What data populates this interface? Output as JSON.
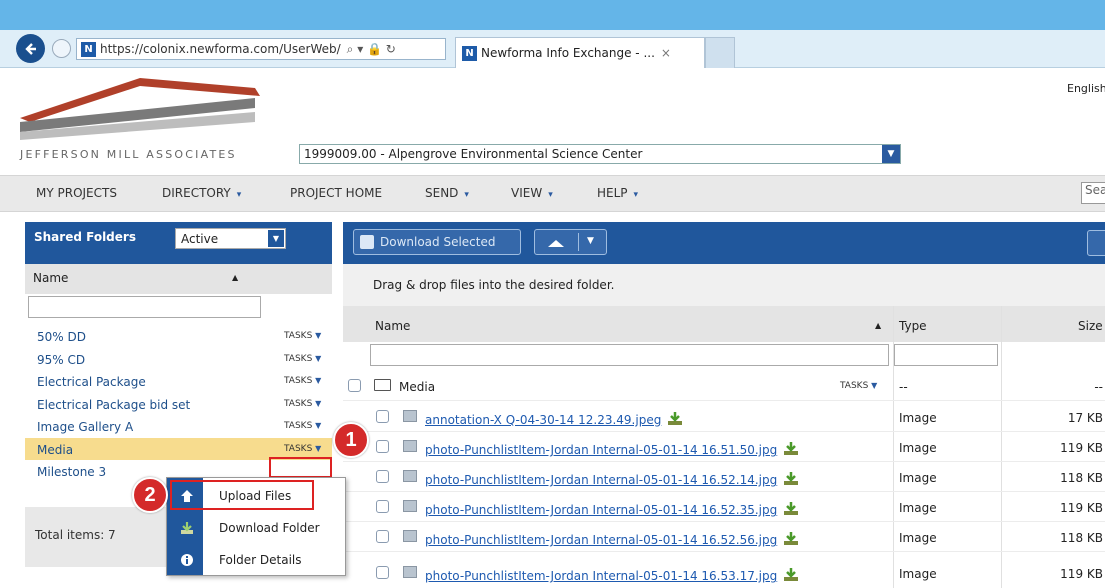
{
  "browser": {
    "url": "https://colonix.newforma.com/UserWeb/",
    "url_icons": "⌕ ▾ 🔒 ↻",
    "tab_title": "Newforma Info Exchange - ...",
    "tab_close": "×",
    "favicon_letter": "N"
  },
  "header": {
    "language": "English",
    "company": "JEFFERSON MILL ASSOCIATES",
    "project": "1999009.00 - Alpengrove Environmental Science Center"
  },
  "menu": {
    "items": [
      {
        "label": "MY PROJECTS",
        "caret": ""
      },
      {
        "label": "DIRECTORY",
        "caret": "▾"
      },
      {
        "label": "PROJECT HOME",
        "caret": ""
      },
      {
        "label": "SEND",
        "caret": "▾"
      },
      {
        "label": "VIEW",
        "caret": "▾"
      },
      {
        "label": "HELP",
        "caret": "▾"
      }
    ],
    "search_placeholder": "Sea"
  },
  "shared_folders": {
    "title": "Shared Folders",
    "filter_value": "Active",
    "column": "Name",
    "tasks_label": "TASKS",
    "folders": [
      "50% DD",
      "95% CD",
      "Electrical Package",
      "Electrical Package bid set",
      "Image Gallery A",
      "Media",
      "Milestone 3"
    ],
    "selected": "Media",
    "total": "Total items: 7"
  },
  "context_menu": {
    "items": [
      "Upload Files",
      "Download Folder",
      "Folder Details"
    ]
  },
  "callouts": [
    "1",
    "2"
  ],
  "files": {
    "download_selected": "Download Selected",
    "drag_hint": "Drag & drop files into the desired folder.",
    "col_name": "Name",
    "col_type": "Type",
    "col_size": "Size",
    "folder_row": {
      "name": "Media",
      "tasks": "TASKS",
      "type": "--",
      "size": "--"
    },
    "rows": [
      {
        "name": "annotation-X Q-04-30-14 12.23.49.jpeg",
        "type": "Image",
        "size": "17 KB"
      },
      {
        "name": "photo-PunchlistItem-Jordan Internal-05-01-14 16.51.50.jpg",
        "type": "Image",
        "size": "119 KB"
      },
      {
        "name": "photo-PunchlistItem-Jordan Internal-05-01-14 16.52.14.jpg",
        "type": "Image",
        "size": "118 KB"
      },
      {
        "name": "photo-PunchlistItem-Jordan Internal-05-01-14 16.52.35.jpg",
        "type": "Image",
        "size": "119 KB"
      },
      {
        "name": "photo-PunchlistItem-Jordan Internal-05-01-14 16.52.56.jpg",
        "type": "Image",
        "size": "118 KB"
      },
      {
        "name": "photo-PunchlistItem-Jordan Internal-05-01-14 16.53.17.jpg",
        "type": "Image",
        "size": "119 KB"
      }
    ]
  },
  "colors": {
    "brand_blue": "#20579c",
    "selected_row": "#f7dc8e",
    "callout_red": "#d42a2a"
  }
}
